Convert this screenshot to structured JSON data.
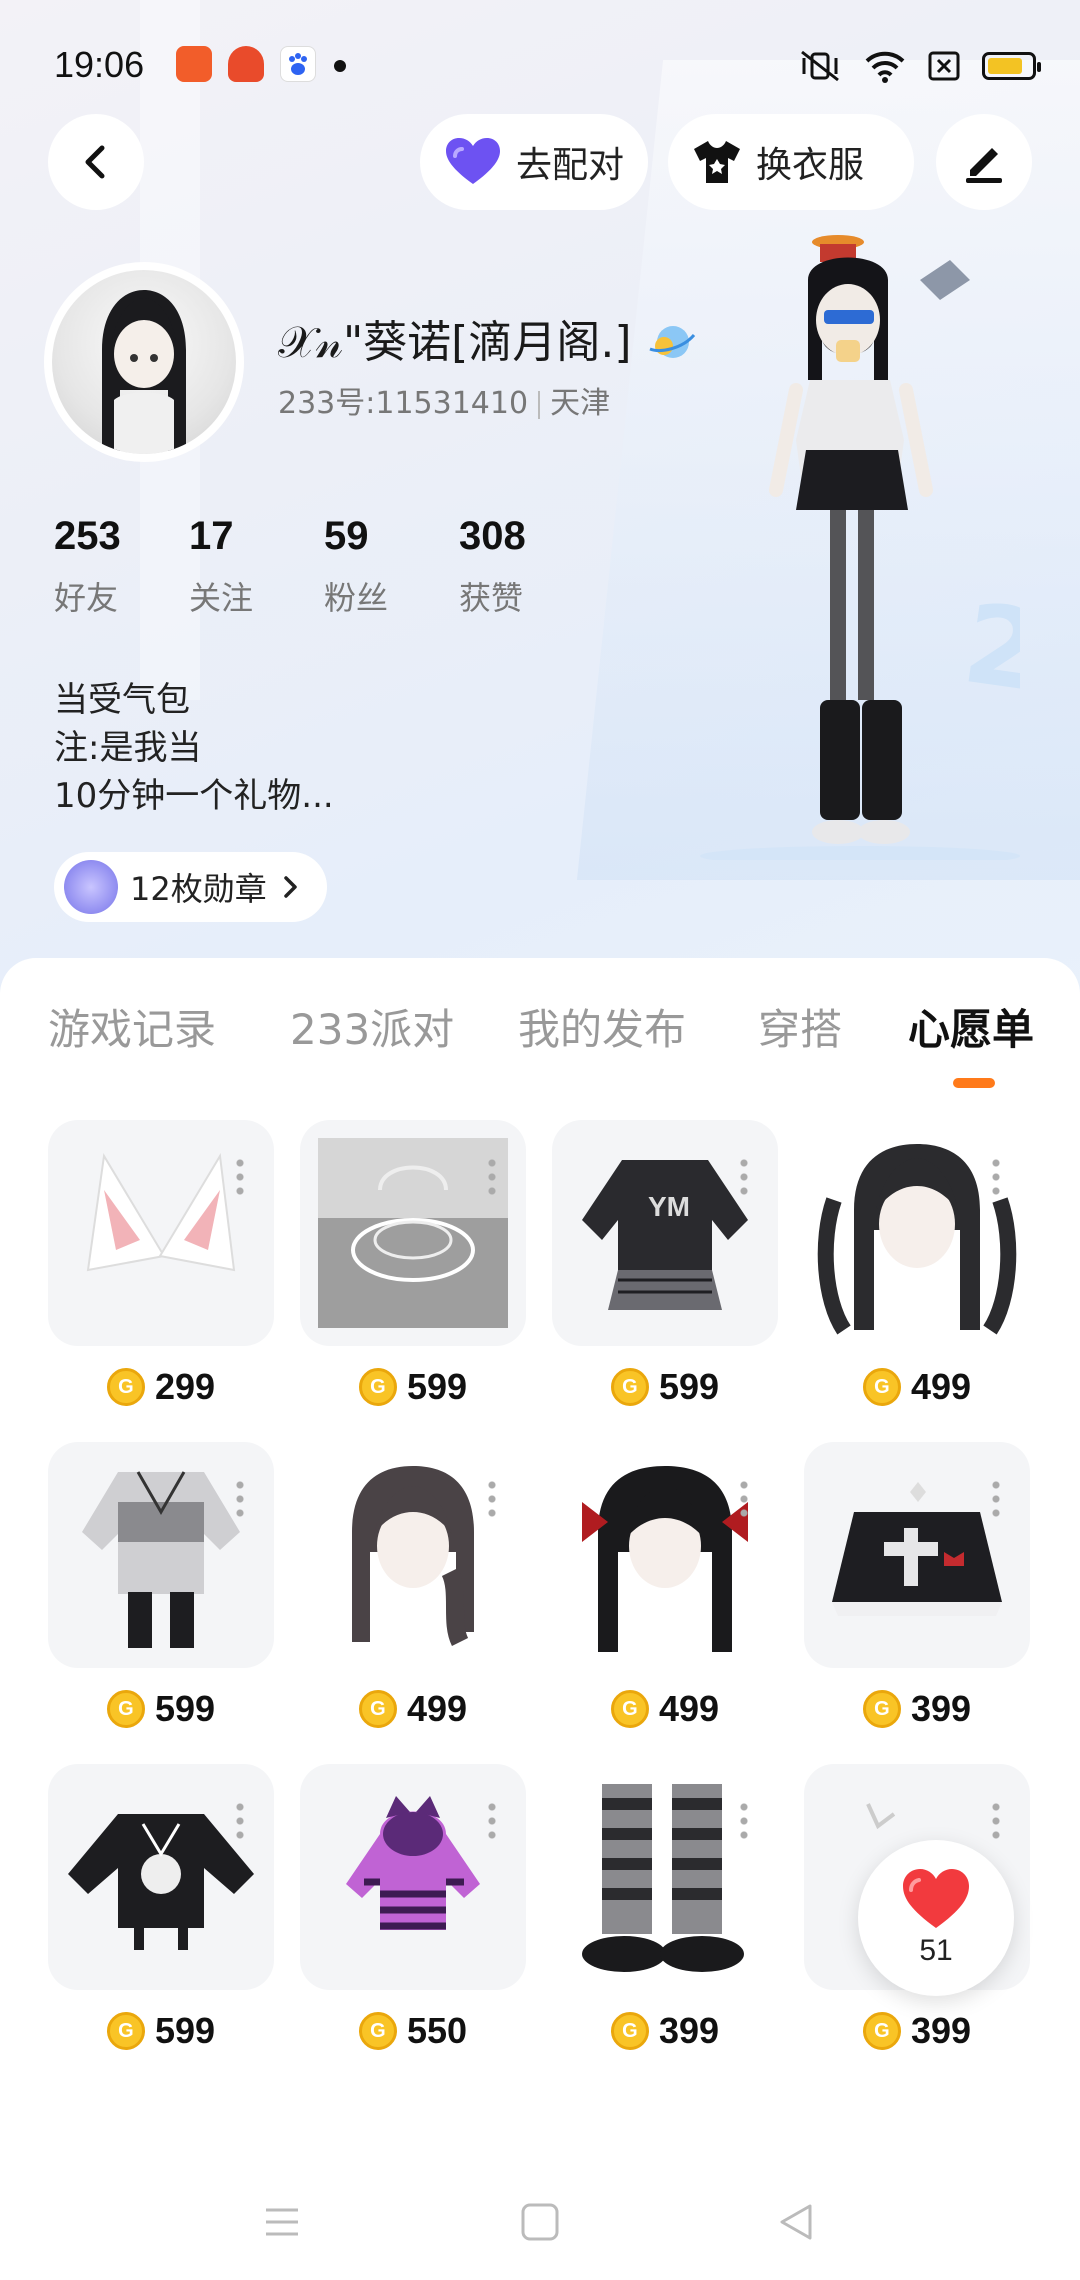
{
  "status": {
    "time": "19:06",
    "battery_color": "#f3c323"
  },
  "top_actions": {
    "match_label": "去配对",
    "dress_label": "换衣服"
  },
  "profile": {
    "username": "𝒳𝓃\"葵诺[滴月阁.]",
    "id_text": "233号:11531410",
    "location": "天津",
    "stats": [
      {
        "value": "253",
        "label": "好友"
      },
      {
        "value": "17",
        "label": "关注"
      },
      {
        "value": "59",
        "label": "粉丝"
      },
      {
        "value": "308",
        "label": "获赞"
      }
    ],
    "bio": [
      "当受气包",
      "注:是我当",
      "10分钟一个礼物..."
    ],
    "medal_label": "12枚勋章"
  },
  "tabs": [
    {
      "label": "游戏记录",
      "active": false
    },
    {
      "label": "233派对",
      "active": false
    },
    {
      "label": "我的发布",
      "active": false
    },
    {
      "label": "穿搭",
      "active": false
    },
    {
      "label": "心愿单",
      "active": true
    }
  ],
  "accent_color": "#ff7a1a",
  "wishlist": [
    {
      "name": "pink-cat-ears",
      "price": "299"
    },
    {
      "name": "crystal-halo-stand",
      "price": "599"
    },
    {
      "name": "black-ym-sweater-outfit",
      "price": "599"
    },
    {
      "name": "twin-tail-black-hair",
      "price": "499"
    },
    {
      "name": "gray-maid-outfit",
      "price": "599"
    },
    {
      "name": "braided-gray-hair",
      "price": "499"
    },
    {
      "name": "red-bow-black-hair",
      "price": "499"
    },
    {
      "name": "black-pleated-skirt",
      "price": "399"
    },
    {
      "name": "black-skeleton-hoodie",
      "price": "599"
    },
    {
      "name": "purple-cat-hoodie",
      "price": "550"
    },
    {
      "name": "striped-boots",
      "price": "399"
    },
    {
      "name": "hidden-item",
      "price": "399"
    }
  ],
  "like": {
    "count": "51"
  }
}
